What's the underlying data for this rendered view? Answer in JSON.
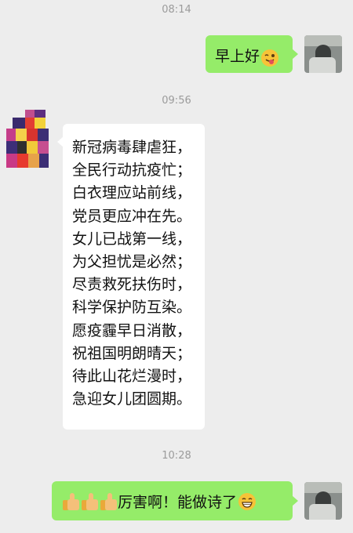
{
  "timestamps": [
    "08:14",
    "09:56",
    "10:28"
  ],
  "messages": {
    "greeting": {
      "text": "早上好",
      "emoji": "winking-face-tongue-icon"
    },
    "poem": {
      "lines": [
        "新冠病毒肆虐狂，",
        "全民行动抗疫忙；",
        "白衣理应站前线，",
        "党员更应冲在先。",
        "女儿已战第一线，",
        "为父担忧是必然；",
        "尽责救死扶伤时，",
        "科学保护防互染。",
        "愿疫霾早日消散，",
        "祝祖国明朗晴天；",
        "待此山花烂漫时，",
        "急迎女儿团圆期。"
      ]
    },
    "reply": {
      "text": "厉害啊！能做诗了",
      "leading_icons": [
        "thumbs-up-icon",
        "thumbs-up-icon",
        "thumbs-up-icon"
      ],
      "trailing_emoji": "grinning-face-icon"
    }
  },
  "colors": {
    "background": "#ededed",
    "bubble_self": "#95ec69",
    "bubble_other": "#ffffff",
    "timestamp": "#9b9b9b"
  }
}
